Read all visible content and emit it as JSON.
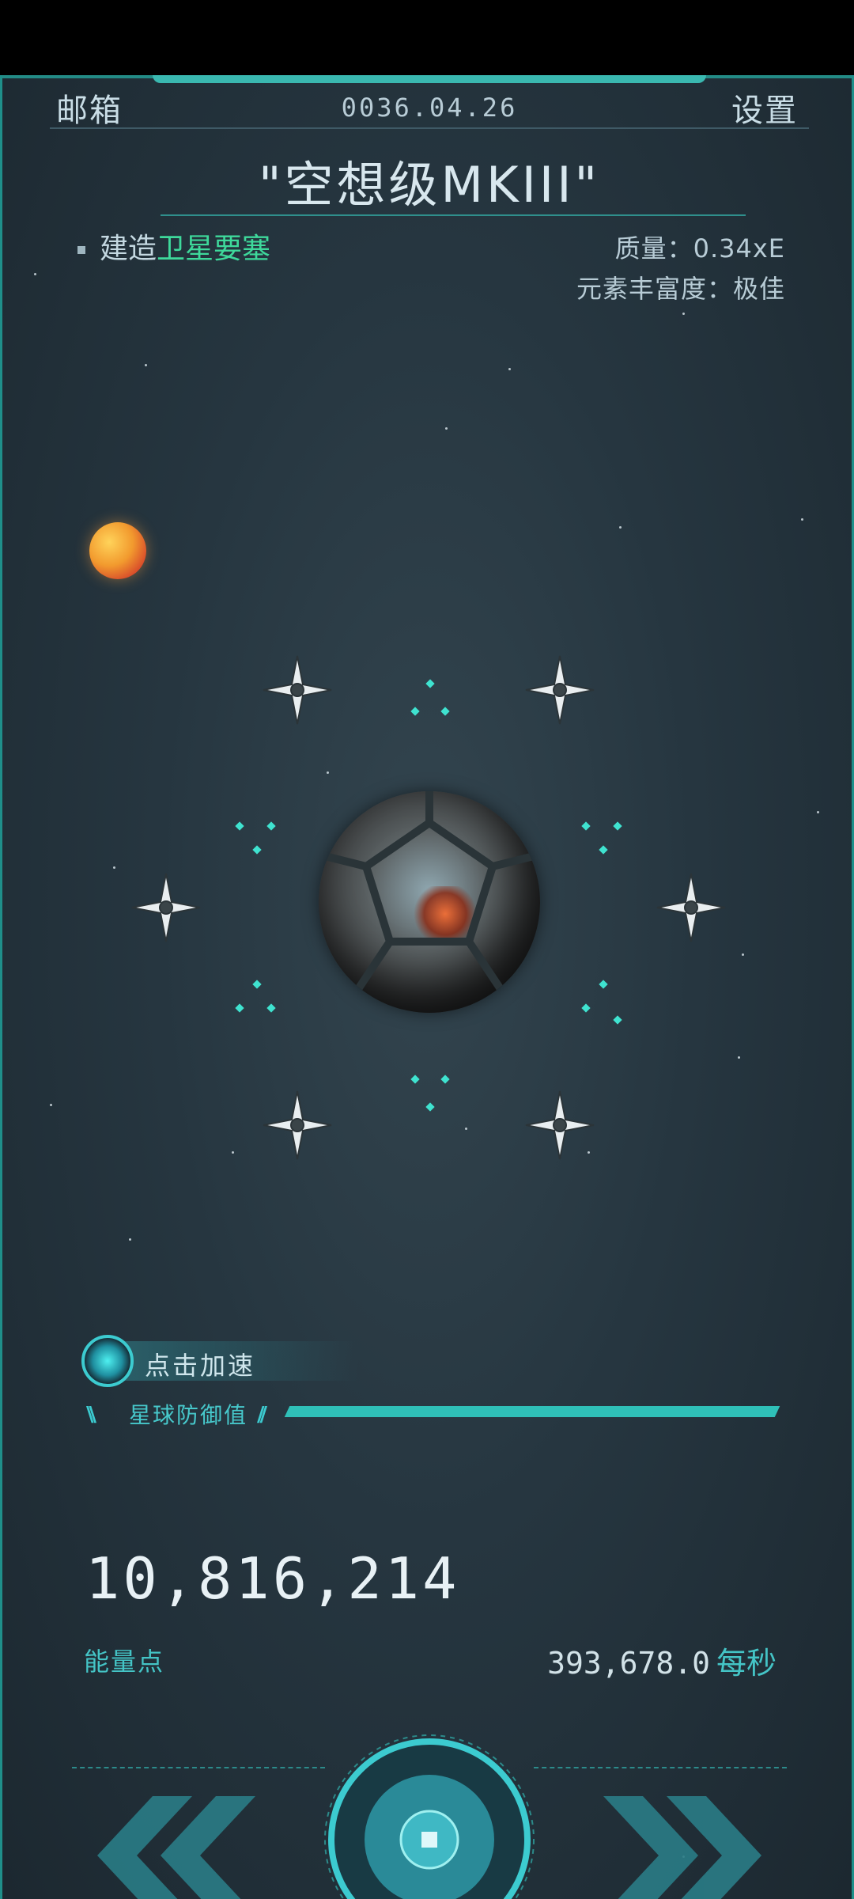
{
  "header": {
    "mailbox_label": "邮箱",
    "date": "0036.04.26",
    "settings_label": "设置"
  },
  "planet": {
    "name": "\"空想级MKIII\"",
    "build_prefix": "建造",
    "build_target": "卫星要塞",
    "mass_label": "质量：0.34xE",
    "abundance_label": "元素丰富度：极佳"
  },
  "defense": {
    "boost_label": "点击加速",
    "defense_label": "星球防御值",
    "defense_level": 1.0
  },
  "energy": {
    "points": "10,816,214",
    "points_label": "能量点",
    "rate_value": "393,678.0",
    "rate_unit": "每秒"
  },
  "colors": {
    "accent": "#3ccbd0",
    "green": "#3ed99b",
    "background": "#263640"
  },
  "icons": {
    "prev": "chevron-double-left-icon",
    "next": "chevron-double-right-icon",
    "center": "core-button-icon",
    "ship": "satellite-ship-icon"
  }
}
